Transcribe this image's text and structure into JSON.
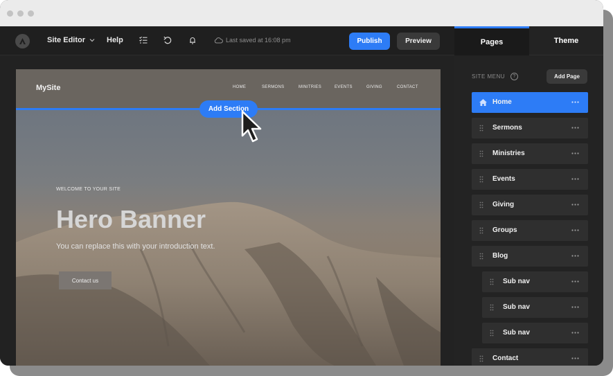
{
  "toolbar": {
    "site_editor_label": "Site Editor",
    "help_label": "Help",
    "saved_text": "Last saved at 16:08 pm",
    "publish_label": "Publish",
    "preview_label": "Preview"
  },
  "panel": {
    "tabs": [
      {
        "label": "Pages",
        "active": true
      },
      {
        "label": "Theme",
        "active": false
      }
    ],
    "site_menu_label": "SITE MENU",
    "help_glyph": "?",
    "add_page_label": "Add Page",
    "pages": [
      {
        "label": "Home",
        "active": true,
        "icon": "home-icon"
      },
      {
        "label": "Sermons"
      },
      {
        "label": "Ministries"
      },
      {
        "label": "Events"
      },
      {
        "label": "Giving"
      },
      {
        "label": "Groups"
      },
      {
        "label": "Blog"
      },
      {
        "label": "Sub nav",
        "level": 2
      },
      {
        "label": "Sub nav",
        "level": 2
      },
      {
        "label": "Sub nav",
        "level": 2
      },
      {
        "label": "Contact"
      }
    ]
  },
  "site": {
    "logo": "MySite",
    "nav": [
      "HOME",
      "SERMONS",
      "MINITRIES",
      "EVENTS",
      "GIVING",
      "CONTACT"
    ],
    "add_section_label": "Add Section",
    "eyebrow": "WELCOME TO YOUR SITE",
    "hero_title": "Hero Banner",
    "hero_subtitle": "You can replace this with your introduction text.",
    "cta_label": "Contact us"
  },
  "colors": {
    "accent": "#2d7cf6",
    "panel_bg": "#232323",
    "item_bg": "#2f2f2f"
  }
}
